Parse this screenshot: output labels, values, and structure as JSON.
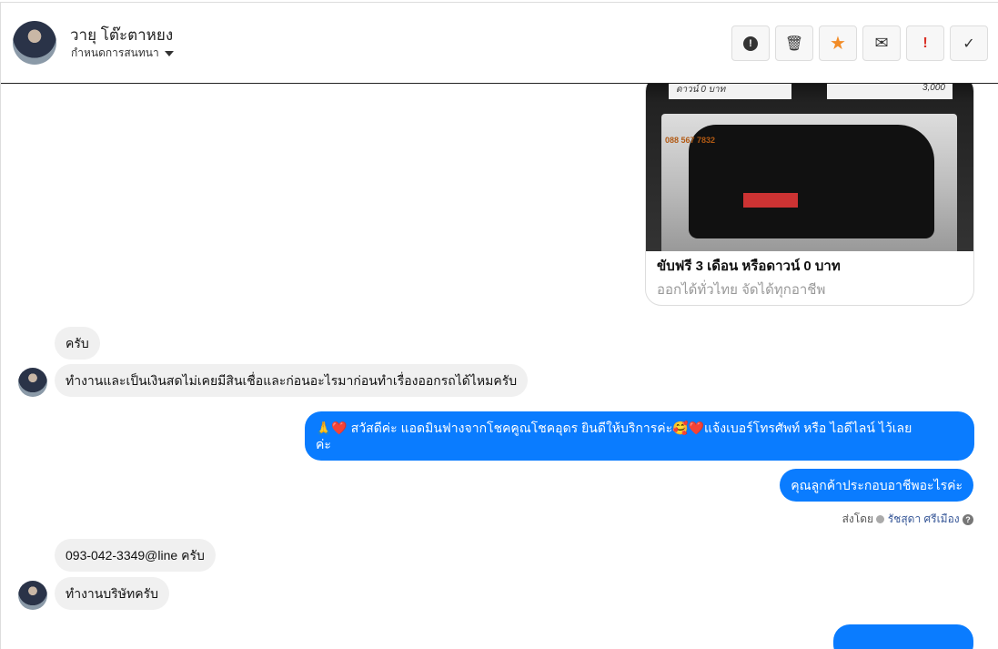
{
  "header": {
    "name": "วายุ โต๊ะตาหยง",
    "assign_label": "กำหนดการสนทนา"
  },
  "actions": [
    {
      "name": "spam",
      "glyph": "!",
      "color": "#333"
    },
    {
      "name": "delete",
      "glyph": "🗑",
      "color": "#333"
    },
    {
      "name": "star",
      "glyph": "★",
      "color": "#f28c28"
    },
    {
      "name": "mail",
      "glyph": "✉",
      "color": "#333"
    },
    {
      "name": "important",
      "glyph": "!",
      "color": "#d93025"
    },
    {
      "name": "done",
      "glyph": "✓",
      "color": "#333"
    }
  ],
  "card": {
    "tag_left": "ดาวน์ 0 บาท",
    "tag_right": "3,000",
    "logo": "088 567 7832",
    "title": "ขับฟรี 3 เดือน หรือดาวน์ 0 บาท",
    "subtitle": "ออกได้ทั่วไทย จัดได้ทุกอาชีพ"
  },
  "messages": [
    {
      "text": "ครับ"
    },
    {
      "text": "ทำงานและเป็นเงินสดไม่เคยมีสินเชื่อและก่อนอะไรมาก่อนทำเรื่องออกรถได้ไหมครับ"
    },
    {
      "text": "🙏❤️ สวัสดีค่ะ แอดมินฟางจากโชคคูณโชคอุดร ยินดีให้บริการค่ะ🥰❤️แจ้งเบอร์โทรศัพท์ หรือ ไอดีไลน์  ไว้เลย",
      "text2": "ค่ะ"
    },
    {
      "text": "คุณลูกค้าประกอบอาชีพอะไรค่ะ"
    },
    {
      "text": "093-042-3349@line ครับ"
    },
    {
      "text": "ทำงานบริษัทครับ"
    }
  ],
  "sent_by": {
    "prefix": "ส่งโดย",
    "agent": "รัชสุดา ศรีเมือง"
  }
}
